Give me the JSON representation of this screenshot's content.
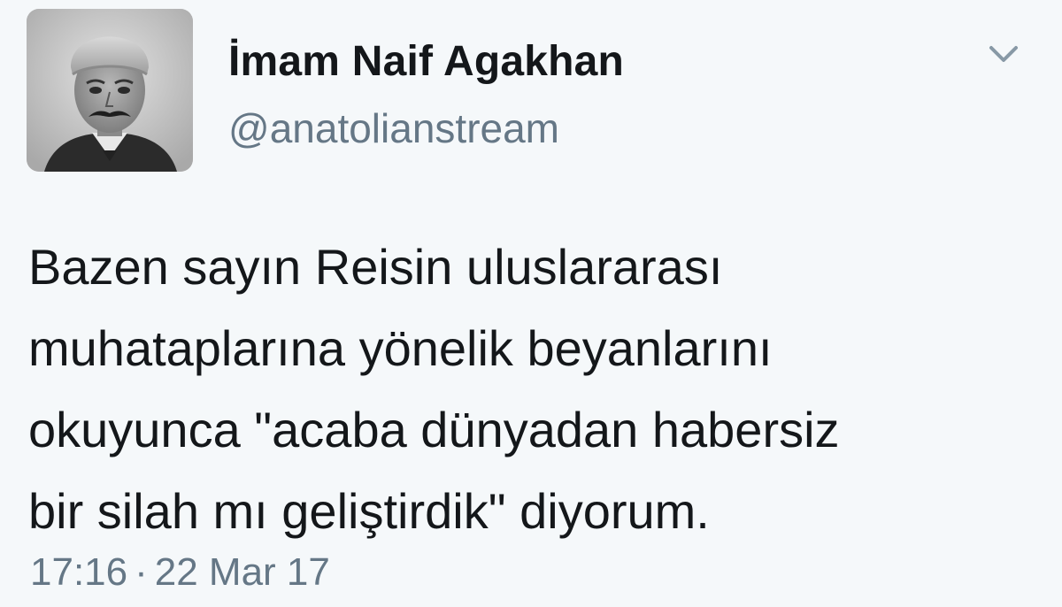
{
  "tweet": {
    "author": {
      "display_name": "İmam Naif Agakhan",
      "handle": "@anatolianstream",
      "avatar_icon": "portrait-photo"
    },
    "menu_icon": "chevron-down-icon",
    "text_lines": [
      "Bazen sayın Reisin uluslararası",
      "muhataplarına yönelik beyanlarını",
      "okuyunca \"acaba dünyadan habersiz",
      "bir silah mı geliştirdik\" diyorum."
    ],
    "time": "17:16",
    "separator": "·",
    "date": "22 Mar 17"
  },
  "colors": {
    "background": "#f5f8fa",
    "text": "#14171a",
    "secondary": "#657786",
    "caret": "#8899a6"
  }
}
